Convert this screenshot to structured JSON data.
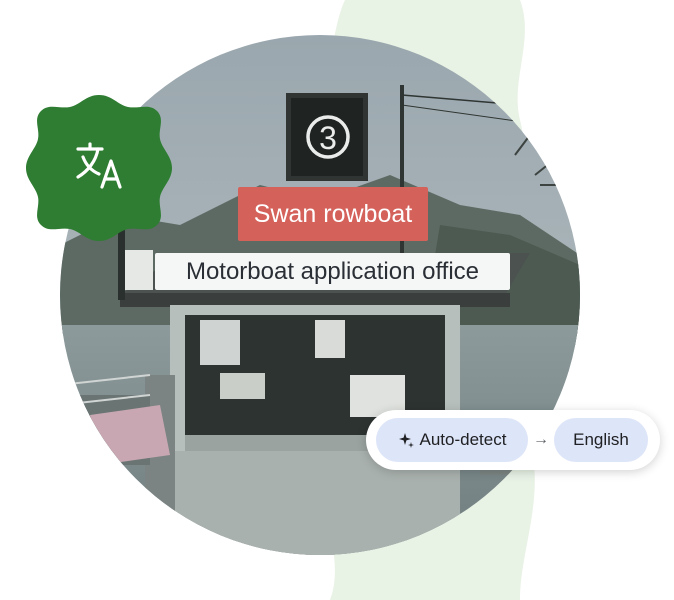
{
  "signs": {
    "top_number": "3",
    "swan_label": "Swan rowboat",
    "office_label": "Motorboat application office"
  },
  "language_bar": {
    "source": "Auto-detect",
    "arrow": "→",
    "target": "English"
  },
  "badge": {
    "icon": "translate-icon"
  },
  "colors": {
    "badge_green": "#2e7d32",
    "pill_bg": "#dde5f8",
    "swan_sign": "#d4625b",
    "background_blob": "#e8f2e5"
  }
}
